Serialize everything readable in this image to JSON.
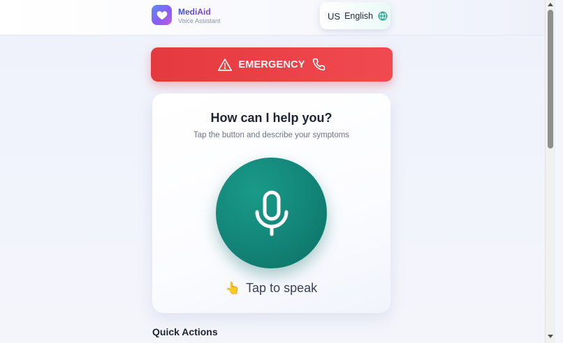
{
  "header": {
    "brand_name": "MediAid",
    "brand_subtitle": "Voice Assistant",
    "logo_icon": "heart-icon",
    "language": {
      "flag_text": "US",
      "label": "English",
      "icon": "globe-icon"
    }
  },
  "emergency": {
    "label": "EMERGENCY",
    "left_icon": "warning-triangle-icon",
    "right_icon": "phone-icon",
    "color": "#e4393f"
  },
  "voice_card": {
    "title": "How can I help you?",
    "subtitle": "Tap the button and describe your symptoms",
    "mic_icon": "microphone-icon",
    "mic_color": "#128477",
    "tap_emoji": "👆",
    "tap_label": "Tap to speak"
  },
  "quick_actions": {
    "title": "Quick Actions"
  }
}
